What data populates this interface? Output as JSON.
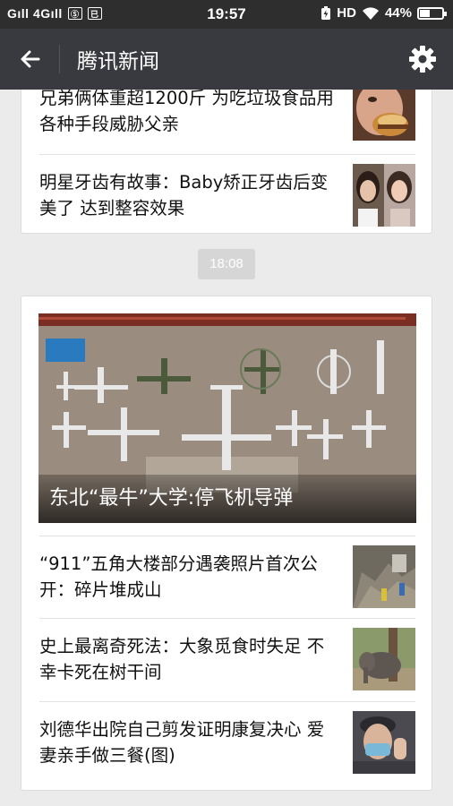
{
  "status_bar": {
    "left": "Gıll 4Gıll",
    "icon_a": "Ⓢ",
    "icon_b": "已",
    "time": "19:57",
    "hd": "HD",
    "battery_text": "44%",
    "battery_level": 0.44
  },
  "titlebar": {
    "title": "腾讯新闻",
    "back_icon": "arrow-left-icon",
    "settings_icon": "gear-icon"
  },
  "card1": {
    "items": [
      {
        "title": "兄弟俩体重超1200斤 为吃垃圾食品用各种手段威胁父亲"
      },
      {
        "title": "明星牙齿有故事：Baby矫正牙齿后变美了 达到整容效果"
      }
    ]
  },
  "time_badge": "18:08",
  "card2": {
    "hero_caption": "东北“最牛”大学:停飞机导弹",
    "items": [
      {
        "title": "“911”五角大楼部分遇袭照片首次公开：碎片堆成山"
      },
      {
        "title": "史上最离奇死法：大象觅食时失足 不幸卡死在树干间"
      },
      {
        "title": "刘德华出院自己剪发证明康复决心 爱妻亲手做三餐(图)"
      }
    ]
  }
}
